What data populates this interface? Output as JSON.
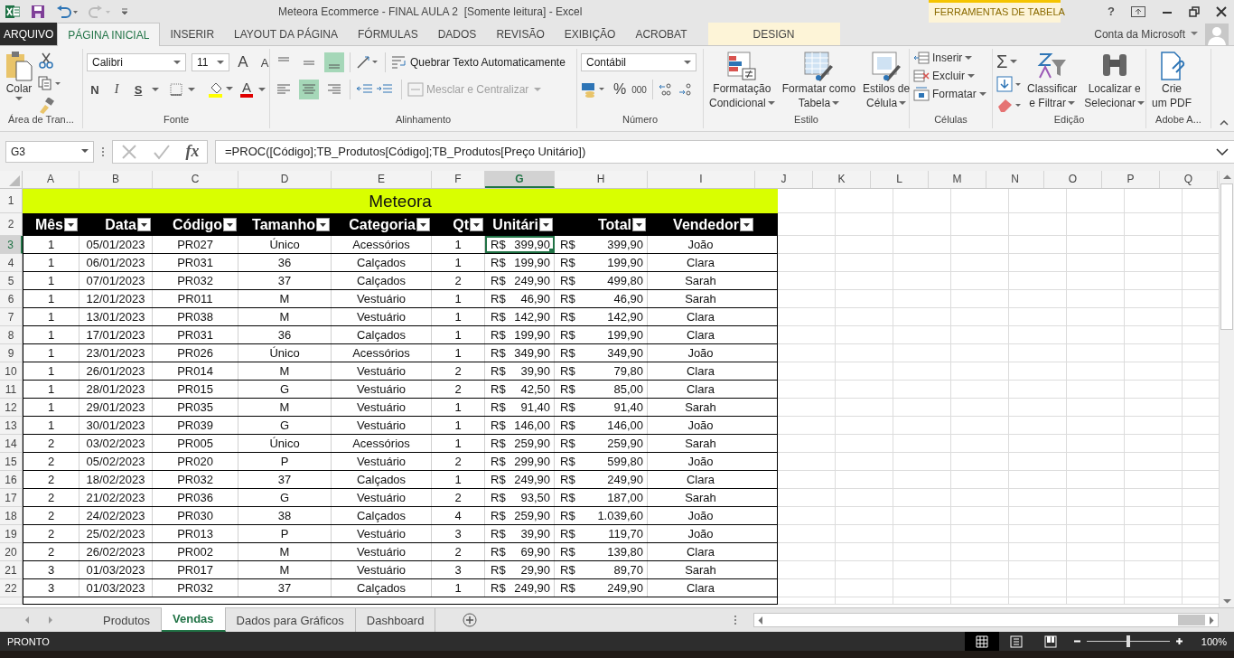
{
  "title_bar": {
    "title": "Meteora Ecommerce - FINAL AULA 2  [Somente leitura] - Excel",
    "contextual_group": "FERRAMENTAS DE TABELA",
    "help": "?",
    "account": "Conta da Microsoft"
  },
  "tabs": [
    {
      "label": "ARQUIVO",
      "kind": "file",
      "selected": false
    },
    {
      "label": "PÁGINA INICIAL",
      "kind": "tab",
      "selected": true
    },
    {
      "label": "INSERIR",
      "kind": "tab",
      "selected": false
    },
    {
      "label": "LAYOUT DA PÁGINA",
      "kind": "tab",
      "selected": false
    },
    {
      "label": "FÓRMULAS",
      "kind": "tab",
      "selected": false
    },
    {
      "label": "DADOS",
      "kind": "tab",
      "selected": false
    },
    {
      "label": "REVISÃO",
      "kind": "tab",
      "selected": false
    },
    {
      "label": "EXIBIÇÃO",
      "kind": "tab",
      "selected": false
    },
    {
      "label": "ACROBAT",
      "kind": "tab",
      "selected": false
    },
    {
      "label": "DESIGN",
      "kind": "contextual",
      "selected": false
    }
  ],
  "ribbon": {
    "clipboard": {
      "label": "Área de Tran...",
      "paste": "Colar"
    },
    "font": {
      "label": "Fonte",
      "font_name": "Calibri",
      "font_size": "11",
      "grow": "A",
      "shrink": "A",
      "bold": "N",
      "italic": "I",
      "underline": "S",
      "font_color": "A"
    },
    "alignment": {
      "label": "Alinhamento",
      "vertical_align": [
        {
          "selected": false
        },
        {
          "selected": false
        },
        {
          "selected": true
        }
      ],
      "horizontal_align": [
        {
          "selected": false
        },
        {
          "selected": true
        },
        {
          "selected": false
        }
      ],
      "wrap_text": "Quebrar Texto Automaticamente",
      "merge": "Mesclar e Centralizar",
      "merge_disabled": true
    },
    "number": {
      "label": "Número",
      "format": "Contábil",
      "percent": "%",
      "thousands": "000"
    },
    "styles": {
      "label": "Estilo",
      "buttons": [
        {
          "kind": "conditional",
          "line1": "Formatação",
          "line2": "Condicional"
        },
        {
          "kind": "table",
          "line1": "Formatar como",
          "line2": "Tabela"
        },
        {
          "kind": "cell",
          "line1": "Estilos de",
          "line2": "Célula"
        }
      ]
    },
    "cells": {
      "label": "Células",
      "buttons": [
        {
          "kind": "insert",
          "label": "Inserir"
        },
        {
          "kind": "delete",
          "label": "Excluir"
        },
        {
          "kind": "format",
          "label": "Formatar"
        }
      ]
    },
    "editing": {
      "label": "Edição",
      "autosum": "Σ",
      "buttons": [
        {
          "kind": "sort",
          "line1": "Classificar",
          "line2": "e Filtrar"
        },
        {
          "kind": "find",
          "line1": "Localizar e",
          "line2": "Selecionar"
        }
      ]
    },
    "adobe": {
      "label": "Adobe A...",
      "line1": "Crie",
      "line2": "um PDF"
    }
  },
  "formula_bar": {
    "name_box": "G3",
    "function_label": "fx",
    "formula": "=PROC([Código];TB_Produtos[Código];TB_Produtos[Preço Unitário])"
  },
  "sheet": {
    "columns": [
      {
        "letter": "A",
        "selected": false
      },
      {
        "letter": "B",
        "selected": false
      },
      {
        "letter": "C",
        "selected": false
      },
      {
        "letter": "D",
        "selected": false
      },
      {
        "letter": "E",
        "selected": false
      },
      {
        "letter": "F",
        "selected": false
      },
      {
        "letter": "G",
        "selected": true
      },
      {
        "letter": "H",
        "selected": false
      },
      {
        "letter": "I",
        "selected": false
      },
      {
        "letter": "J",
        "selected": false
      },
      {
        "letter": "K",
        "selected": false
      },
      {
        "letter": "L",
        "selected": false
      },
      {
        "letter": "M",
        "selected": false
      },
      {
        "letter": "N",
        "selected": false
      },
      {
        "letter": "O",
        "selected": false
      },
      {
        "letter": "P",
        "selected": false
      },
      {
        "letter": "Q",
        "selected": false
      }
    ],
    "title_row": {
      "n": "1",
      "selected": false,
      "title": "Meteora"
    },
    "header_row": {
      "n": "2",
      "selected": false,
      "headers": [
        "Mês",
        "Data",
        "Código",
        "Tamanho",
        "Categoria",
        "Qt",
        "Unitári",
        "Total",
        "Vendedor"
      ]
    },
    "rows": [
      {
        "n": "3",
        "selected": true,
        "cells": [
          "1",
          "05/01/2023",
          "PR027",
          "Único",
          "Acessórios",
          "1"
        ],
        "unit": {
          "currency": "R$",
          "amount": "399,90"
        },
        "total": {
          "currency": "R$",
          "amount": "399,90"
        },
        "vendedor": "João"
      },
      {
        "n": "4",
        "selected": false,
        "cells": [
          "1",
          "06/01/2023",
          "PR031",
          "36",
          "Calçados",
          "1"
        ],
        "unit": {
          "currency": "R$",
          "amount": "199,90"
        },
        "total": {
          "currency": "R$",
          "amount": "199,90"
        },
        "vendedor": "Clara"
      },
      {
        "n": "5",
        "selected": false,
        "cells": [
          "1",
          "07/01/2023",
          "PR032",
          "37",
          "Calçados",
          "2"
        ],
        "unit": {
          "currency": "R$",
          "amount": "249,90"
        },
        "total": {
          "currency": "R$",
          "amount": "499,80"
        },
        "vendedor": "Sarah"
      },
      {
        "n": "6",
        "selected": false,
        "cells": [
          "1",
          "12/01/2023",
          "PR011",
          "M",
          "Vestuário",
          "1"
        ],
        "unit": {
          "currency": "R$",
          "amount": "46,90"
        },
        "total": {
          "currency": "R$",
          "amount": "46,90"
        },
        "vendedor": "Sarah"
      },
      {
        "n": "7",
        "selected": false,
        "cells": [
          "1",
          "13/01/2023",
          "PR038",
          "M",
          "Vestuário",
          "1"
        ],
        "unit": {
          "currency": "R$",
          "amount": "142,90"
        },
        "total": {
          "currency": "R$",
          "amount": "142,90"
        },
        "vendedor": "Clara"
      },
      {
        "n": "8",
        "selected": false,
        "cells": [
          "1",
          "17/01/2023",
          "PR031",
          "36",
          "Calçados",
          "1"
        ],
        "unit": {
          "currency": "R$",
          "amount": "199,90"
        },
        "total": {
          "currency": "R$",
          "amount": "199,90"
        },
        "vendedor": "Clara"
      },
      {
        "n": "9",
        "selected": false,
        "cells": [
          "1",
          "23/01/2023",
          "PR026",
          "Único",
          "Acessórios",
          "1"
        ],
        "unit": {
          "currency": "R$",
          "amount": "349,90"
        },
        "total": {
          "currency": "R$",
          "amount": "349,90"
        },
        "vendedor": "João"
      },
      {
        "n": "10",
        "selected": false,
        "cells": [
          "1",
          "26/01/2023",
          "PR014",
          "M",
          "Vestuário",
          "2"
        ],
        "unit": {
          "currency": "R$",
          "amount": "39,90"
        },
        "total": {
          "currency": "R$",
          "amount": "79,80"
        },
        "vendedor": "Clara"
      },
      {
        "n": "11",
        "selected": false,
        "cells": [
          "1",
          "28/01/2023",
          "PR015",
          "G",
          "Vestuário",
          "2"
        ],
        "unit": {
          "currency": "R$",
          "amount": "42,50"
        },
        "total": {
          "currency": "R$",
          "amount": "85,00"
        },
        "vendedor": "Clara"
      },
      {
        "n": "12",
        "selected": false,
        "cells": [
          "1",
          "29/01/2023",
          "PR035",
          "M",
          "Vestuário",
          "1"
        ],
        "unit": {
          "currency": "R$",
          "amount": "91,40"
        },
        "total": {
          "currency": "R$",
          "amount": "91,40"
        },
        "vendedor": "Sarah"
      },
      {
        "n": "13",
        "selected": false,
        "cells": [
          "1",
          "30/01/2023",
          "PR039",
          "G",
          "Vestuário",
          "1"
        ],
        "unit": {
          "currency": "R$",
          "amount": "146,00"
        },
        "total": {
          "currency": "R$",
          "amount": "146,00"
        },
        "vendedor": "João"
      },
      {
        "n": "14",
        "selected": false,
        "cells": [
          "2",
          "03/02/2023",
          "PR005",
          "Único",
          "Acessórios",
          "1"
        ],
        "unit": {
          "currency": "R$",
          "amount": "259,90"
        },
        "total": {
          "currency": "R$",
          "amount": "259,90"
        },
        "vendedor": "Sarah"
      },
      {
        "n": "15",
        "selected": false,
        "cells": [
          "2",
          "05/02/2023",
          "PR020",
          "P",
          "Vestuário",
          "2"
        ],
        "unit": {
          "currency": "R$",
          "amount": "299,90"
        },
        "total": {
          "currency": "R$",
          "amount": "599,80"
        },
        "vendedor": "João"
      },
      {
        "n": "16",
        "selected": false,
        "cells": [
          "2",
          "18/02/2023",
          "PR032",
          "37",
          "Calçados",
          "1"
        ],
        "unit": {
          "currency": "R$",
          "amount": "249,90"
        },
        "total": {
          "currency": "R$",
          "amount": "249,90"
        },
        "vendedor": "Clara"
      },
      {
        "n": "17",
        "selected": false,
        "cells": [
          "2",
          "21/02/2023",
          "PR036",
          "G",
          "Vestuário",
          "2"
        ],
        "unit": {
          "currency": "R$",
          "amount": "93,50"
        },
        "total": {
          "currency": "R$",
          "amount": "187,00"
        },
        "vendedor": "Sarah"
      },
      {
        "n": "18",
        "selected": false,
        "cells": [
          "2",
          "24/02/2023",
          "PR030",
          "38",
          "Calçados",
          "4"
        ],
        "unit": {
          "currency": "R$",
          "amount": "259,90"
        },
        "total": {
          "currency": "R$",
          "amount": "1.039,60"
        },
        "vendedor": "João"
      },
      {
        "n": "19",
        "selected": false,
        "cells": [
          "2",
          "25/02/2023",
          "PR013",
          "P",
          "Vestuário",
          "3"
        ],
        "unit": {
          "currency": "R$",
          "amount": "39,90"
        },
        "total": {
          "currency": "R$",
          "amount": "119,70"
        },
        "vendedor": "João"
      },
      {
        "n": "20",
        "selected": false,
        "cells": [
          "2",
          "26/02/2023",
          "PR002",
          "M",
          "Vestuário",
          "2"
        ],
        "unit": {
          "currency": "R$",
          "amount": "69,90"
        },
        "total": {
          "currency": "R$",
          "amount": "139,80"
        },
        "vendedor": "Clara"
      },
      {
        "n": "21",
        "selected": false,
        "cells": [
          "3",
          "01/03/2023",
          "PR017",
          "M",
          "Vestuário",
          "3"
        ],
        "unit": {
          "currency": "R$",
          "amount": "29,90"
        },
        "total": {
          "currency": "R$",
          "amount": "89,70"
        },
        "vendedor": "Sarah"
      },
      {
        "n": "22",
        "selected": false,
        "cells": [
          "3",
          "01/03/2023",
          "PR032",
          "37",
          "Calçados",
          "1"
        ],
        "unit": {
          "currency": "R$",
          "amount": "249,90"
        },
        "total": {
          "currency": "R$",
          "amount": "249,90"
        },
        "vendedor": "Clara"
      }
    ]
  },
  "sheet_tabs": [
    {
      "label": "Produtos",
      "selected": false
    },
    {
      "label": "Vendas",
      "selected": true
    },
    {
      "label": "Dados para Gráficos",
      "selected": false
    },
    {
      "label": "Dashboard",
      "selected": false
    }
  ],
  "status_bar": {
    "text": "PRONTO",
    "views": [
      {
        "kind": "normal",
        "selected": true
      },
      {
        "kind": "page_layout",
        "selected": false
      },
      {
        "kind": "page_break",
        "selected": false
      }
    ],
    "zoom": {
      "level": 0.5,
      "reading": "100%"
    }
  }
}
